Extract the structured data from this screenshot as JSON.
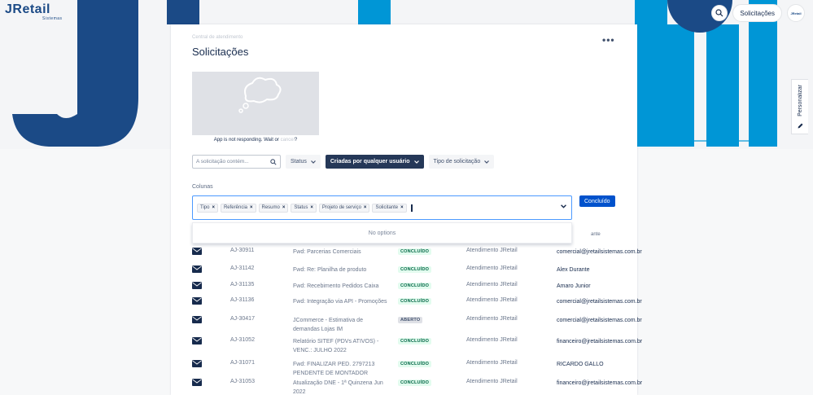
{
  "brand": {
    "logo": "JRetail",
    "sub": "Sistemas",
    "avatar": "JRetail"
  },
  "header": {
    "requests_label": "Solicitações"
  },
  "side": {
    "personalize_label": "Personalizar"
  },
  "page": {
    "breadcrumb": "Central de atendimento",
    "title": "Solicitações",
    "app_msg_prefix": "App is not responding. Wait or",
    "app_msg_link": "cancel",
    "app_msg_suffix": "?"
  },
  "filters": {
    "search_placeholder": "A solicitação contém...",
    "status_label": "Status",
    "created_by_label": "Criadas por qualquer usuário",
    "type_label": "Tipo de solicitação"
  },
  "columns": {
    "label": "Colunas",
    "selected": [
      "Tipo",
      "Referência",
      "Resumo",
      "Status",
      "Projeto de serviço",
      "Solicitante"
    ],
    "no_options": "No options",
    "done_label": "Concluído"
  },
  "table": {
    "requester_header_partial": "ante",
    "rows": [
      {
        "ref": "AJ-30911",
        "summary": "Fwd: Parcerias Comerciais",
        "status": "CONCLUÍDO",
        "status_type": "ok",
        "service": "Atendimento JRetail",
        "requester": "comercial@jretailsistemas.com.br"
      },
      {
        "ref": "AJ-31142",
        "summary": "Fwd: Re: Planilha de produto",
        "status": "CONCLUÍDO",
        "status_type": "ok",
        "service": "Atendimento JRetail",
        "requester": "Alex Durante"
      },
      {
        "ref": "AJ-31135",
        "summary": "Fwd: Recebimento Pedidos Caixa",
        "status": "CONCLUÍDO",
        "status_type": "ok",
        "service": "Atendimento JRetail",
        "requester": "Amaro Junior"
      },
      {
        "ref": "AJ-31136",
        "summary": "Fwd: Integração via API - Promoções",
        "status": "CONCLUÍDO",
        "status_type": "ok",
        "service": "Atendimento JRetail",
        "requester": "comercial@jretailsistemas.com.br"
      },
      {
        "ref": "AJ-30417",
        "summary": "JCommerce - Estimativa de demandas Lojas IM",
        "status": "ABERTO",
        "status_type": "open",
        "service": "Atendimento JRetail",
        "requester": "comercial@jretailsistemas.com.br"
      },
      {
        "ref": "AJ-31052",
        "summary": "Relatório SITEF (PDVs ATIVOS) - VENC.: JULHO 2022",
        "status": "CONCLUÍDO",
        "status_type": "ok",
        "service": "Atendimento JRetail",
        "requester": "financeiro@jretailsistemas.com.br"
      },
      {
        "ref": "AJ-31071",
        "summary": "Fwd: FINALIZAR PED. 2797213 PENDENTE DE MONTADOR",
        "status": "CONCLUÍDO",
        "status_type": "ok",
        "service": "Atendimento JRetail",
        "requester": "RICARDO GALLO"
      },
      {
        "ref": "AJ-31053",
        "summary": "Atualização DNE - 1ª Quinzena Jun 2022",
        "status": "CONCLUÍDO",
        "status_type": "ok",
        "service": "Atendimento JRetail",
        "requester": "financeiro@jretailsistemas.com.br"
      }
    ]
  },
  "colors": {
    "accent": "#0052cc",
    "dark": "#253858",
    "brand_blue": "#1b4a86",
    "light_blue": "#0096d6"
  }
}
